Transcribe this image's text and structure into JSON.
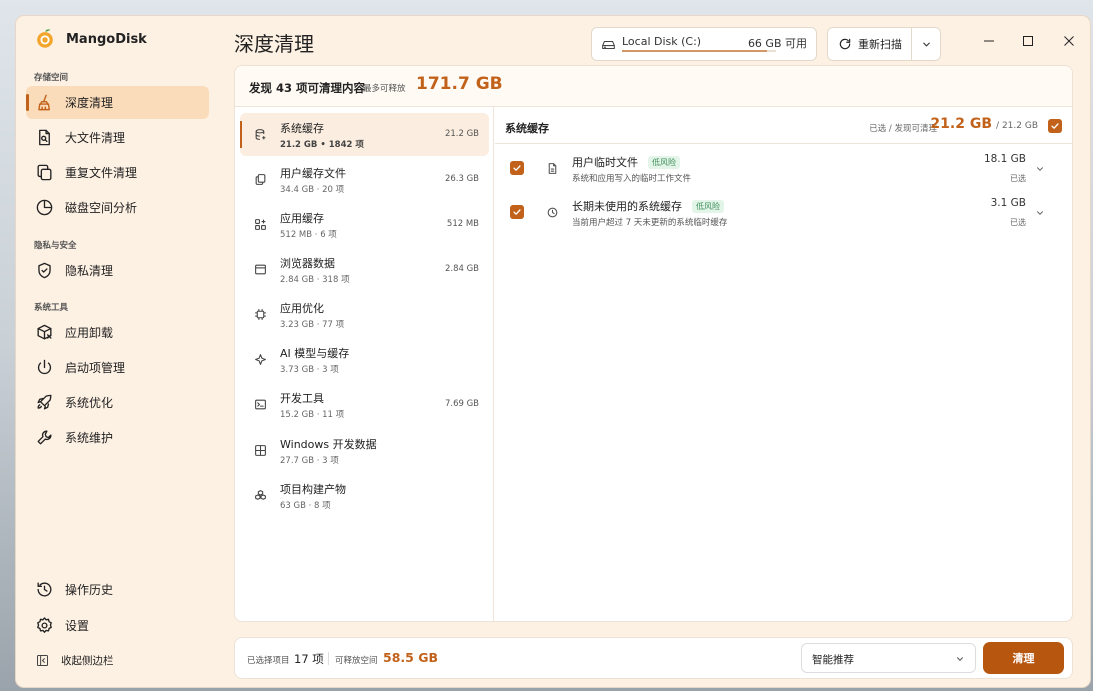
{
  "app": {
    "name": "MangoDisk"
  },
  "sidebar": {
    "sections": [
      "存储空间",
      "隐私与安全",
      "系统工具"
    ],
    "items": [
      {
        "label": "深度清理",
        "icon": "broom-icon"
      },
      {
        "label": "大文件清理",
        "icon": "file-search-icon"
      },
      {
        "label": "重复文件清理",
        "icon": "copy-icon"
      },
      {
        "label": "磁盘空间分析",
        "icon": "pie-chart-icon"
      },
      {
        "label": "隐私清理",
        "icon": "shield-check-icon"
      },
      {
        "label": "应用卸载",
        "icon": "package-x-icon"
      },
      {
        "label": "启动项管理",
        "icon": "power-icon"
      },
      {
        "label": "系统优化",
        "icon": "rocket-icon"
      },
      {
        "label": "系统维护",
        "icon": "wrench-icon"
      }
    ],
    "bottom": [
      {
        "label": "操作历史",
        "icon": "history-icon"
      },
      {
        "label": "设置",
        "icon": "gear-icon"
      },
      {
        "label": "收起侧边栏",
        "icon": "collapse-sidebar-icon"
      }
    ]
  },
  "header": {
    "title": "深度清理",
    "disk": {
      "name": "Local Disk (C:)",
      "free": "66 GB 可用",
      "used_fraction": 0.94
    },
    "rescan": "重新扫描"
  },
  "summary": {
    "found": "发现 43 项可清理内容",
    "max_label": "最多可释放",
    "max_value": "171.7 GB"
  },
  "categories": [
    {
      "name": "系统缓存",
      "sub": "21.2 GB • 1842 项",
      "size": "21.2 GB",
      "icon": "database-icon"
    },
    {
      "name": "用户缓存文件",
      "sub": "34.4 GB · 20 项",
      "size": "26.3 GB",
      "icon": "files-icon"
    },
    {
      "name": "应用缓存",
      "sub": "512 MB · 6 项",
      "size": "512 MB",
      "icon": "apps-icon"
    },
    {
      "name": "浏览器数据",
      "sub": "2.84 GB · 318 项",
      "size": "2.84 GB",
      "icon": "browser-icon"
    },
    {
      "name": "应用优化",
      "sub": "3.23 GB · 77 项",
      "size": "",
      "icon": "chip-icon"
    },
    {
      "name": "AI 模型与缓存",
      "sub": "3.73 GB · 3 项",
      "size": "",
      "icon": "sparkle-icon"
    },
    {
      "name": "开发工具",
      "sub": "15.2 GB · 11 项",
      "size": "7.69 GB",
      "icon": "terminal-icon"
    },
    {
      "name": "Windows 开发数据",
      "sub": "27.7 GB · 3 项",
      "size": "",
      "icon": "windows-icon"
    },
    {
      "name": "项目构建产物",
      "sub": "63 GB · 8 项",
      "size": "",
      "icon": "boxes-icon"
    }
  ],
  "detail": {
    "title": "系统缓存",
    "selected_label": "已选 / 发现可清理",
    "selected_value": "21.2 GB",
    "total": "/ 21.2 GB",
    "items": [
      {
        "name": "用户临时文件",
        "badge": "低风险",
        "desc": "系统和应用写入的临时工作文件",
        "size": "18.1 GB",
        "state": "已选",
        "icon": "document-icon"
      },
      {
        "name": "长期未使用的系统缓存",
        "badge": "低风险",
        "desc": "当前用户超过 7 天未更新的系统临时缓存",
        "size": "3.1 GB",
        "state": "已选",
        "icon": "clock-icon"
      }
    ]
  },
  "footer": {
    "selected_label": "已选择项目",
    "selected_count": "17 项",
    "free_label": "可释放空间",
    "free_value": "58.5 GB",
    "mode": "智能推荐",
    "clean": "清理"
  },
  "colors": {
    "accent": "#c2621a",
    "button": "#b7560f",
    "active_bg": "#fbdcba"
  }
}
